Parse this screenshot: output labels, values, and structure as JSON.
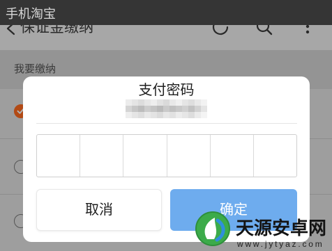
{
  "window": {
    "title": "手机淘宝"
  },
  "header": {
    "title": "保证金缴纳",
    "icons": {
      "back": "chevron-left-icon",
      "refresh": "refresh-icon",
      "search": "search-icon",
      "more": "more-vertical-icon"
    }
  },
  "section": {
    "label": "我要缴纳"
  },
  "options": [
    {
      "selected": true
    },
    {
      "selected": false
    },
    {
      "selected": false
    }
  ],
  "dialog": {
    "title": "支付密码",
    "password": {
      "cells": 6,
      "value": ""
    },
    "cancel_label": "取消",
    "confirm_label": "确定"
  },
  "watermark": {
    "logo_icon": "watermark-logo-icon",
    "name": "天源安卓网",
    "url": "www.jytyaz.com"
  },
  "colors": {
    "title_bar": "#353535",
    "accent_orange": "#ff6a1f",
    "confirm_blue": "#6eacee"
  }
}
